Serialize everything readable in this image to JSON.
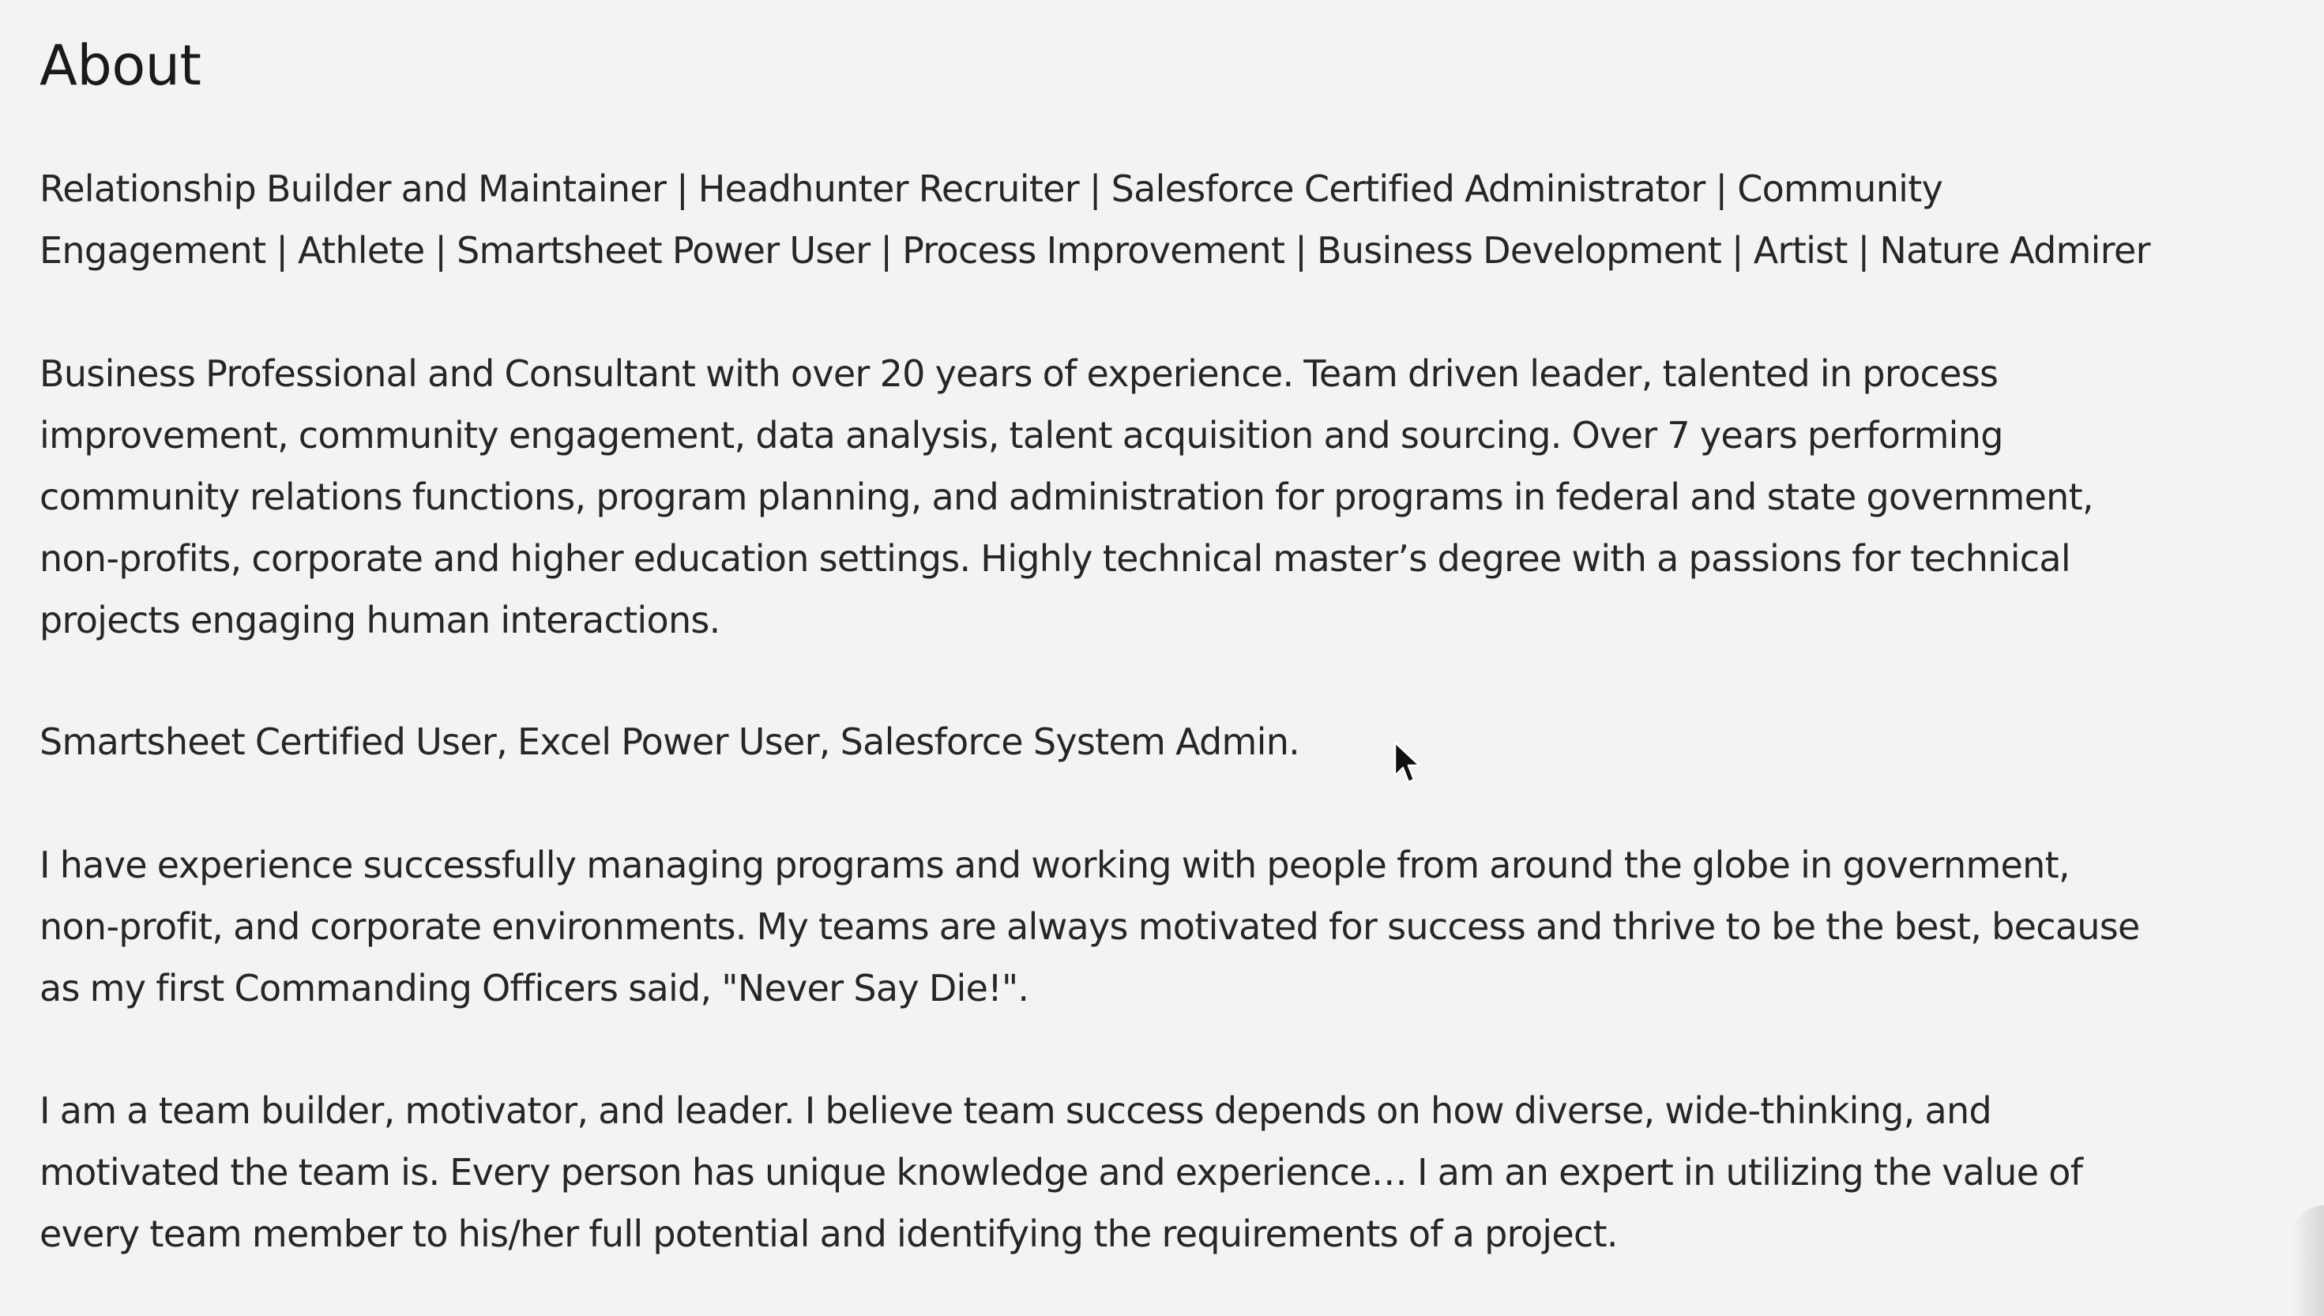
{
  "section": {
    "title": "About",
    "paragraphs": [
      "Relationship Builder and Maintainer | Headhunter Recruiter | Salesforce Certified Administrator | Community\nEngagement | Athlete | Smartsheet Power User | Process Improvement | Business Development | Artist | Nature Admirer",
      "Business Professional and Consultant with over 20 years of experience. Team driven leader, talented in process\nimprovement, community engagement, data analysis, talent acquisition and sourcing. Over 7 years performing\ncommunity relations functions, program planning, and administration for programs in federal and state government,\nnon-profits, corporate and higher education settings. Highly technical master’s degree with a passions for technical\nprojects engaging human interactions.",
      "Smartsheet Certified User, Excel Power User, Salesforce System Admin.",
      "I have experience successfully managing programs and working with people from around the globe in government,\nnon-profit, and corporate environments. My teams are always motivated for success and thrive to be the best, because\nas my first Commanding Officers said, \"Never Say Die!\".",
      "I am a team builder, motivator, and leader. I believe team success depends on how diverse, wide-thinking, and\nmotivated the team is. Every person has unique knowledge and experience… I am an expert in utilizing the value of\nevery team member to his/her full potential and identifying the requirements of a project."
    ]
  },
  "icons": {
    "cursor": "mouse-pointer-icon"
  },
  "colors": {
    "background": "#f3f3f3",
    "text": "#262626"
  }
}
